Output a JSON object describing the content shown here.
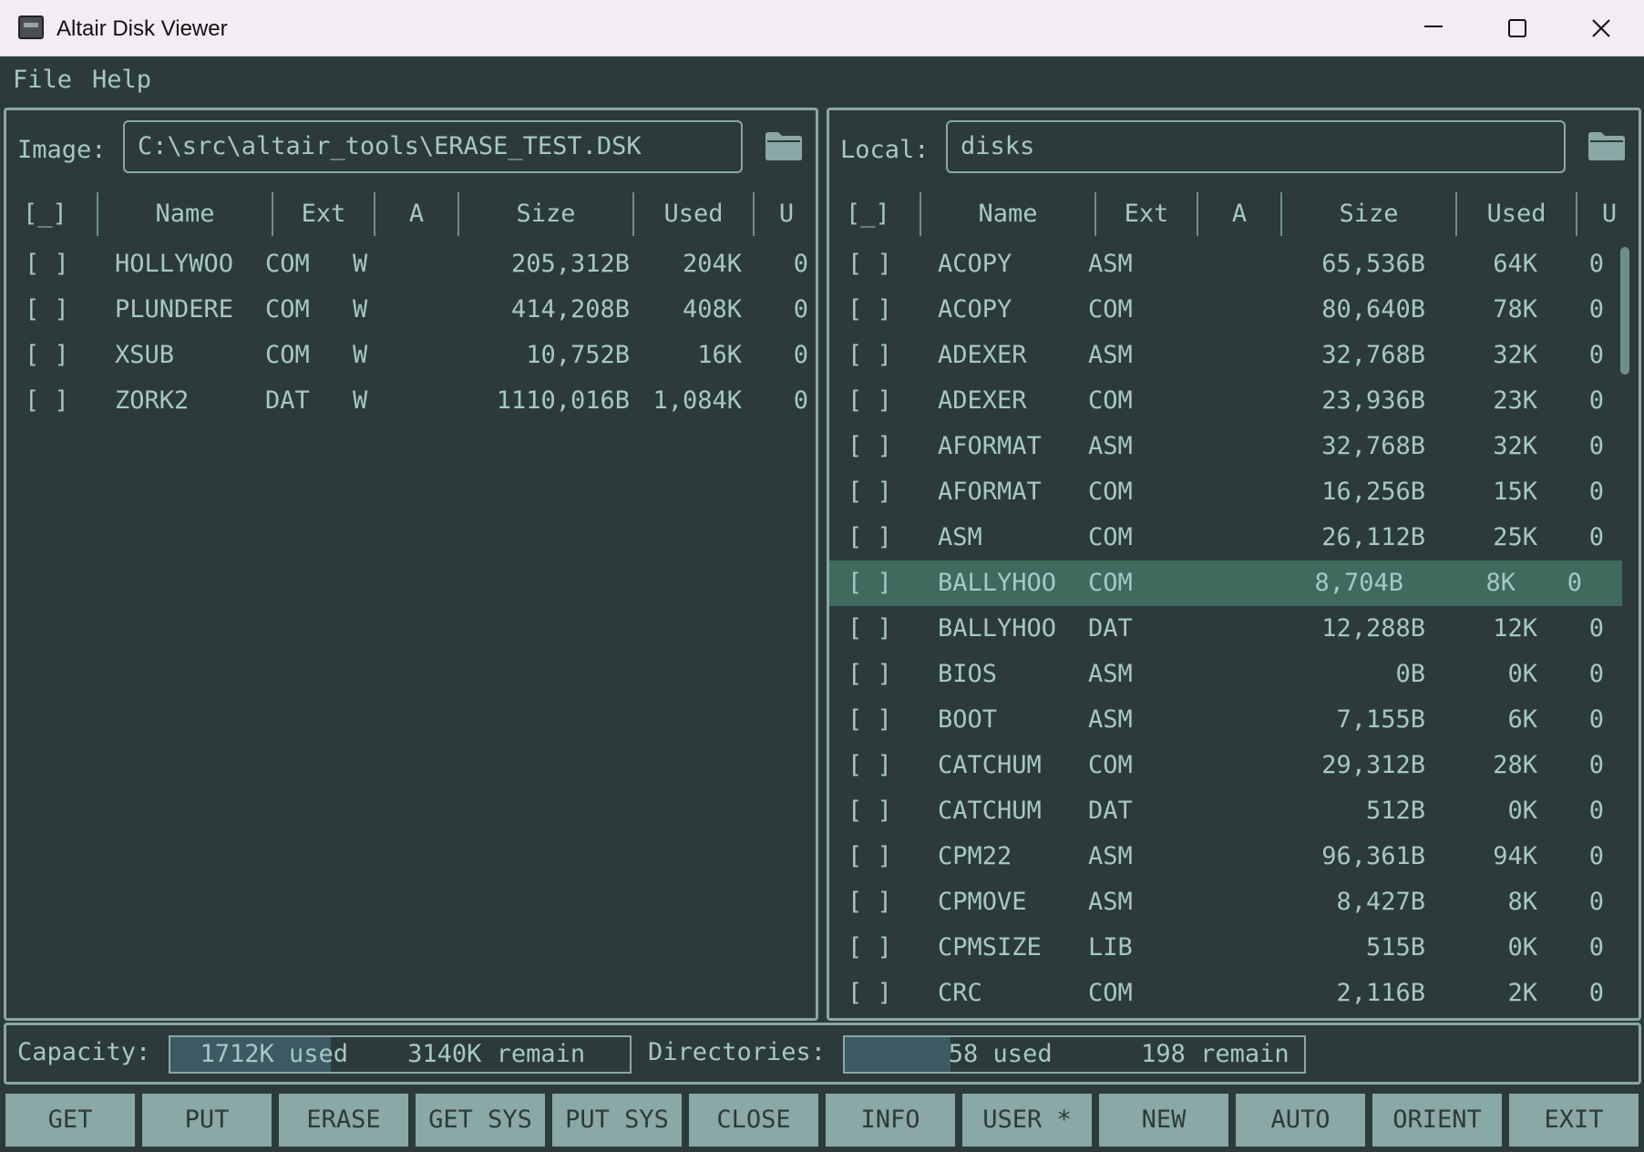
{
  "window": {
    "title": "Altair Disk Viewer",
    "icon": "disk-viewer-icon"
  },
  "menu": {
    "file": "File",
    "help": "Help"
  },
  "left_panel": {
    "label": "Image:",
    "path": "C:\\src\\altair_tools\\ERASE_TEST.DSK",
    "columns": [
      "[_]",
      "Name",
      "Ext",
      "A",
      "Size",
      "Used",
      "U"
    ],
    "rows": [
      {
        "chk": "[ ]",
        "name": "HOLLYWOO",
        "ext": "COM",
        "attr": "W",
        "size": "205,312B",
        "used": "204K",
        "user": "0"
      },
      {
        "chk": "[ ]",
        "name": "PLUNDERE",
        "ext": "COM",
        "attr": "W",
        "size": "414,208B",
        "used": "408K",
        "user": "0"
      },
      {
        "chk": "[ ]",
        "name": "XSUB",
        "ext": "COM",
        "attr": "W",
        "size": "10,752B",
        "used": "16K",
        "user": "0"
      },
      {
        "chk": "[ ]",
        "name": "ZORK2",
        "ext": "DAT",
        "attr": "W",
        "size": "1110,016B",
        "used": "1,084K",
        "user": "0"
      }
    ]
  },
  "right_panel": {
    "label": "Local:",
    "path": "disks",
    "columns": [
      "[_]",
      "Name",
      "Ext",
      "A",
      "Size",
      "Used",
      "U"
    ],
    "selected_index": 7,
    "rows": [
      {
        "chk": "[ ]",
        "name": "ACOPY",
        "ext": "ASM",
        "attr": "",
        "size": "65,536B",
        "used": "64K",
        "user": "0"
      },
      {
        "chk": "[ ]",
        "name": "ACOPY",
        "ext": "COM",
        "attr": "",
        "size": "80,640B",
        "used": "78K",
        "user": "0"
      },
      {
        "chk": "[ ]",
        "name": "ADEXER",
        "ext": "ASM",
        "attr": "",
        "size": "32,768B",
        "used": "32K",
        "user": "0"
      },
      {
        "chk": "[ ]",
        "name": "ADEXER",
        "ext": "COM",
        "attr": "",
        "size": "23,936B",
        "used": "23K",
        "user": "0"
      },
      {
        "chk": "[ ]",
        "name": "AFORMAT",
        "ext": "ASM",
        "attr": "",
        "size": "32,768B",
        "used": "32K",
        "user": "0"
      },
      {
        "chk": "[ ]",
        "name": "AFORMAT",
        "ext": "COM",
        "attr": "",
        "size": "16,256B",
        "used": "15K",
        "user": "0"
      },
      {
        "chk": "[ ]",
        "name": "ASM",
        "ext": "COM",
        "attr": "",
        "size": "26,112B",
        "used": "25K",
        "user": "0"
      },
      {
        "chk": "[ ]",
        "name": "BALLYHOO",
        "ext": "COM",
        "attr": "",
        "size": "8,704B",
        "used": "8K",
        "user": "0"
      },
      {
        "chk": "[ ]",
        "name": "BALLYHOO",
        "ext": "DAT",
        "attr": "",
        "size": "12,288B",
        "used": "12K",
        "user": "0"
      },
      {
        "chk": "[ ]",
        "name": "BIOS",
        "ext": "ASM",
        "attr": "",
        "size": "0B",
        "used": "0K",
        "user": "0"
      },
      {
        "chk": "[ ]",
        "name": "BOOT",
        "ext": "ASM",
        "attr": "",
        "size": "7,155B",
        "used": "6K",
        "user": "0"
      },
      {
        "chk": "[ ]",
        "name": "CATCHUM",
        "ext": "COM",
        "attr": "",
        "size": "29,312B",
        "used": "28K",
        "user": "0"
      },
      {
        "chk": "[ ]",
        "name": "CATCHUM",
        "ext": "DAT",
        "attr": "",
        "size": "512B",
        "used": "0K",
        "user": "0"
      },
      {
        "chk": "[ ]",
        "name": "CPM22",
        "ext": "ASM",
        "attr": "",
        "size": "96,361B",
        "used": "94K",
        "user": "0"
      },
      {
        "chk": "[ ]",
        "name": "CPMOVE",
        "ext": "ASM",
        "attr": "",
        "size": "8,427B",
        "used": "8K",
        "user": "0"
      },
      {
        "chk": "[ ]",
        "name": "CPMSIZE",
        "ext": "LIB",
        "attr": "",
        "size": "515B",
        "used": "0K",
        "user": "0"
      },
      {
        "chk": "[ ]",
        "name": "CRC",
        "ext": "COM",
        "attr": "",
        "size": "2,116B",
        "used": "2K",
        "user": "0"
      }
    ]
  },
  "status": {
    "capacity_label": "Capacity:",
    "capacity_text": "  1712K used    3140K remain",
    "capacity_fraction": 0.35,
    "dirs_label": "Directories:",
    "dirs_text": "       58 used      198 remain",
    "dirs_fraction": 0.23
  },
  "buttons": [
    "GET",
    "PUT",
    "ERASE",
    "GET SYS",
    "PUT SYS",
    "CLOSE",
    "INFO",
    "USER *",
    "NEW",
    "AUTO",
    "ORIENT",
    "EXIT"
  ],
  "colors": {
    "background": "#2c3a3b",
    "text": "#a6c8c4",
    "border": "#8aa8a5",
    "selected_row": "#3f6a5d",
    "gauge_fill": "#3b5a63"
  }
}
